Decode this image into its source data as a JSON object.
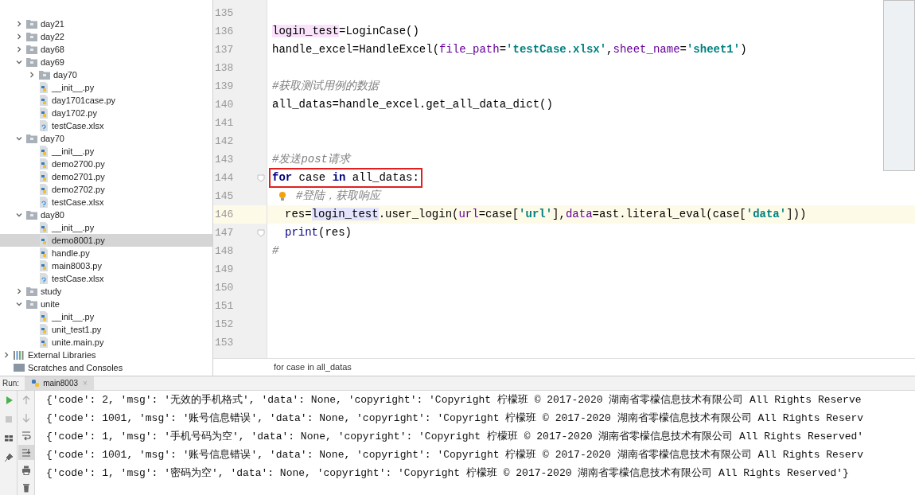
{
  "project_tree": [
    {
      "name": "day21",
      "kind": "folder",
      "expanded": false,
      "selected": false
    },
    {
      "name": "day22",
      "kind": "folder",
      "expanded": false,
      "selected": false
    },
    {
      "name": "day68",
      "kind": "folder",
      "expanded": false,
      "selected": false
    },
    {
      "name": "day69",
      "kind": "folder",
      "expanded": true,
      "selected": false,
      "children": [
        {
          "name": "day70",
          "kind": "folder",
          "expanded": false,
          "selected": false
        },
        {
          "name": "__init__.py",
          "kind": "python",
          "selected": false
        },
        {
          "name": "day1701case.py",
          "kind": "python",
          "selected": false
        },
        {
          "name": "day1702.py",
          "kind": "python",
          "selected": false
        },
        {
          "name": "testCase.xlsx",
          "kind": "unknown",
          "selected": false
        }
      ]
    },
    {
      "name": "day70",
      "kind": "folder",
      "expanded": true,
      "selected": false,
      "children": [
        {
          "name": "__init__.py",
          "kind": "python",
          "selected": false
        },
        {
          "name": "demo2700.py",
          "kind": "python",
          "selected": false
        },
        {
          "name": "demo2701.py",
          "kind": "python",
          "selected": false
        },
        {
          "name": "demo2702.py",
          "kind": "python",
          "selected": false
        },
        {
          "name": "testCase.xlsx",
          "kind": "unknown",
          "selected": false
        }
      ]
    },
    {
      "name": "day80",
      "kind": "folder",
      "expanded": true,
      "selected": false,
      "children": [
        {
          "name": "__init__.py",
          "kind": "python",
          "selected": false
        },
        {
          "name": "demo8001.py",
          "kind": "python",
          "selected": true
        },
        {
          "name": "handle.py",
          "kind": "python",
          "selected": false
        },
        {
          "name": "main8003.py",
          "kind": "python",
          "selected": false
        },
        {
          "name": "testCase.xlsx",
          "kind": "unknown",
          "selected": false
        }
      ]
    },
    {
      "name": "study",
      "kind": "folder",
      "expanded": false,
      "selected": false
    },
    {
      "name": "unite",
      "kind": "folder",
      "expanded": true,
      "selected": false,
      "children": [
        {
          "name": "__init__.py",
          "kind": "python",
          "selected": false
        },
        {
          "name": "unit_test1.py",
          "kind": "python",
          "selected": false
        },
        {
          "name": "unite.main.py",
          "kind": "python",
          "selected": false
        }
      ]
    }
  ],
  "project_extras": [
    {
      "name": "External Libraries",
      "kind": "library",
      "expanded": false,
      "selected": false
    },
    {
      "name": "Scratches and Consoles",
      "kind": "scratches",
      "selected": false
    }
  ],
  "editor": {
    "lines": [
      {
        "number": "135",
        "current": false
      },
      {
        "number": "136",
        "current": false,
        "tokens": [
          {
            "text": "login_test",
            "kind": "write_usage"
          },
          {
            "text": "=LoginCase()",
            "kind": "plain"
          }
        ]
      },
      {
        "number": "137",
        "current": false,
        "tokens": [
          {
            "text": "handle_excel=HandleExcel(",
            "kind": "plain"
          },
          {
            "text": "file_path",
            "kind": "param"
          },
          {
            "text": "=",
            "kind": "plain"
          },
          {
            "text": "'testCase.xlsx'",
            "kind": "string"
          },
          {
            "text": ",",
            "kind": "plain"
          },
          {
            "text": "sheet_name",
            "kind": "param"
          },
          {
            "text": "=",
            "kind": "plain"
          },
          {
            "text": "'sheet1'",
            "kind": "string"
          },
          {
            "text": ")",
            "kind": "plain"
          }
        ]
      },
      {
        "number": "138",
        "current": false
      },
      {
        "number": "139",
        "current": false,
        "tokens": [
          {
            "text": "#获取测试用例的数据",
            "kind": "comment"
          }
        ]
      },
      {
        "number": "140",
        "current": false,
        "tokens": [
          {
            "text": "all_datas=handle_excel.get_all_data_dict()",
            "kind": "plain"
          }
        ]
      },
      {
        "number": "141",
        "current": false
      },
      {
        "number": "142",
        "current": false
      },
      {
        "number": "143",
        "current": false,
        "tokens": [
          {
            "text": "#发送post请求",
            "kind": "comment"
          }
        ]
      },
      {
        "number": "144",
        "current": false,
        "boxed": true,
        "fold": true,
        "tokens": [
          {
            "text": "for",
            "kind": "keyword"
          },
          {
            "text": " case ",
            "kind": "plain"
          },
          {
            "text": "in",
            "kind": "keyword"
          },
          {
            "text": " all_datas:",
            "kind": "plain"
          }
        ]
      },
      {
        "number": "145",
        "current": false,
        "indent": true,
        "bulb": true,
        "tokens": [
          {
            "text": "#登陆，获取响应",
            "kind": "comment"
          }
        ]
      },
      {
        "number": "146",
        "current": true,
        "indent": true,
        "tokens": [
          {
            "text": "res=",
            "kind": "plain"
          },
          {
            "text": "login_test",
            "kind": "read_usage"
          },
          {
            "text": ".user_login(",
            "kind": "plain"
          },
          {
            "text": "url",
            "kind": "param"
          },
          {
            "text": "=case[",
            "kind": "plain"
          },
          {
            "text": "'url'",
            "kind": "string"
          },
          {
            "text": "],",
            "kind": "plain"
          },
          {
            "text": "data",
            "kind": "param"
          },
          {
            "text": "=ast.literal_eval(case[",
            "kind": "plain"
          },
          {
            "text": "'data'",
            "kind": "string"
          },
          {
            "text": "]))",
            "kind": "plain"
          }
        ]
      },
      {
        "number": "147",
        "current": false,
        "indent": true,
        "fold": true,
        "tokens": [
          {
            "text": "print",
            "kind": "builtin"
          },
          {
            "text": "(res)",
            "kind": "plain"
          }
        ]
      },
      {
        "number": "148",
        "current": false,
        "tokens": [
          {
            "text": "#",
            "kind": "comment"
          }
        ]
      },
      {
        "number": "149",
        "current": false
      },
      {
        "number": "150",
        "current": false
      },
      {
        "number": "151",
        "current": false
      },
      {
        "number": "152",
        "current": false
      },
      {
        "number": "153",
        "current": false
      }
    ],
    "breadcrumb": "for case in all_datas"
  },
  "run_panel": {
    "label": "Run:",
    "tab": {
      "title": "main8003",
      "close": "×",
      "selected": true
    },
    "toolbar": [
      {
        "kind": "play",
        "selected": false
      },
      {
        "kind": "stop",
        "selected": false
      },
      {
        "kind": "layout",
        "selected": false
      },
      {
        "kind": "pin",
        "selected": false
      }
    ],
    "toolbar_2": [
      {
        "kind": "up",
        "selected": false
      },
      {
        "kind": "down",
        "selected": false
      },
      {
        "kind": "wrap",
        "selected": false
      },
      {
        "kind": "scroll_end",
        "selected": true
      },
      {
        "kind": "print",
        "selected": false
      },
      {
        "kind": "trash",
        "selected": false
      }
    ],
    "output": [
      "{'code': 2, 'msg': '无效的手机格式', 'data': None, 'copyright': 'Copyright 柠檬班 © 2017-2020 湖南省零檬信息技术有限公司 All Rights Reserve",
      "{'code': 1001, 'msg': '账号信息错误', 'data': None, 'copyright': 'Copyright 柠檬班 © 2017-2020 湖南省零檬信息技术有限公司 All Rights Reserv",
      "{'code': 1, 'msg': '手机号码为空', 'data': None, 'copyright': 'Copyright 柠檬班 © 2017-2020 湖南省零檬信息技术有限公司 All Rights Reserved'",
      "{'code': 1001, 'msg': '账号信息错误', 'data': None, 'copyright': 'Copyright 柠檬班 © 2017-2020 湖南省零檬信息技术有限公司 All Rights Reserv",
      "{'code': 1, 'msg': '密码为空', 'data': None, 'copyright': 'Copyright 柠檬班 © 2017-2020 湖南省零檬信息技术有限公司 All Rights Reserved'}"
    ]
  }
}
